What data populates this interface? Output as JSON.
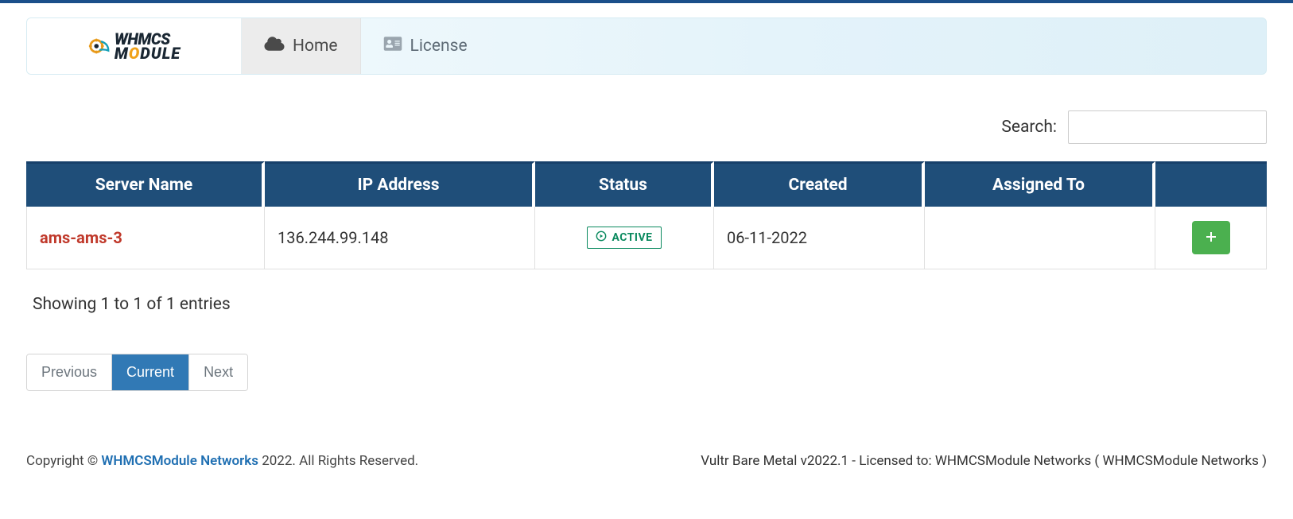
{
  "brand": {
    "line1": "WHMCS",
    "line2_pre": "M",
    "line2_o": "O",
    "line2_post": "DULE"
  },
  "nav": {
    "home": "Home",
    "license": "License"
  },
  "search": {
    "label": "Search:",
    "value": "",
    "placeholder": ""
  },
  "table": {
    "headers": {
      "server_name": "Server Name",
      "ip_address": "IP Address",
      "status": "Status",
      "created": "Created",
      "assigned_to": "Assigned To",
      "action": ""
    },
    "rows": [
      {
        "server_name": "ams-ams-3",
        "ip_address": "136.244.99.148",
        "status": "ACTIVE",
        "created": "06-11-2022",
        "assigned_to": ""
      }
    ]
  },
  "entries_info": "Showing 1 to 1 of 1 entries",
  "pagination": {
    "previous": "Previous",
    "current": "Current",
    "next": "Next"
  },
  "footer": {
    "copyright_prefix": "Copyright © ",
    "company": "WHMCSModule Networks",
    "copyright_suffix": " 2022. All Rights Reserved.",
    "right": "Vultr Bare Metal v2022.1 - Licensed to: WHMCSModule Networks ( WHMCSModule Networks )"
  }
}
